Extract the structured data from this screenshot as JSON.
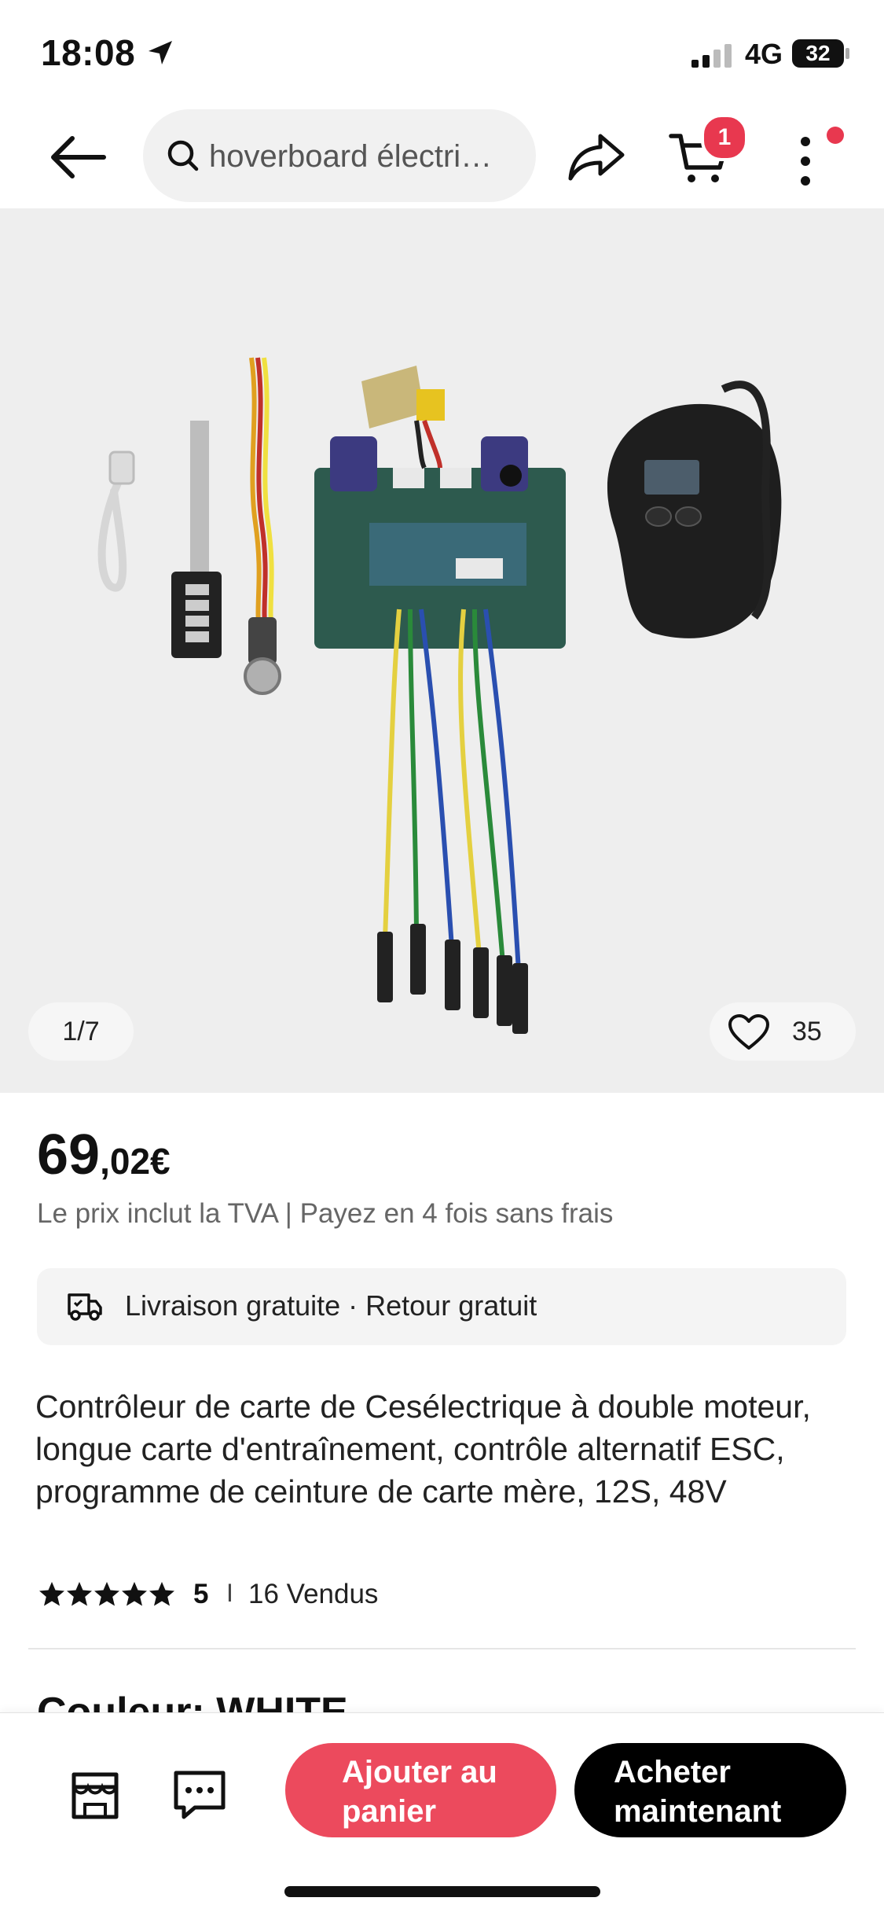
{
  "status_bar": {
    "time": "18:08",
    "network": "4G",
    "battery": "32"
  },
  "header": {
    "search_placeholder": "hoverboard électri…",
    "cart_badge": "1"
  },
  "gallery": {
    "counter": "1/7",
    "likes": "35",
    "image_alt": "Product image"
  },
  "price": {
    "integer": "69",
    "decimal": ",02€",
    "note": "Le prix inclut la TVA | Payez en 4 fois sans frais"
  },
  "shipping": {
    "text": "Livraison gratuite · Retour gratuit"
  },
  "product": {
    "title": "Contrôleur de carte de Cesélectrique à double moteur, longue carte d'entraînement, contrôle alternatif ESC, programme de ceinture de carte mère, 12S, 48V",
    "rating": "5",
    "sep": "I",
    "sold": "16 Vendus",
    "color_label": "Couleur: WHITE →"
  },
  "actions": {
    "add_to_cart": "Ajouter au panier",
    "buy_now": "Acheter maintenant"
  },
  "colors": {
    "accent": "#ec4a5d",
    "badge": "#e8384f",
    "buy": "#000000"
  }
}
